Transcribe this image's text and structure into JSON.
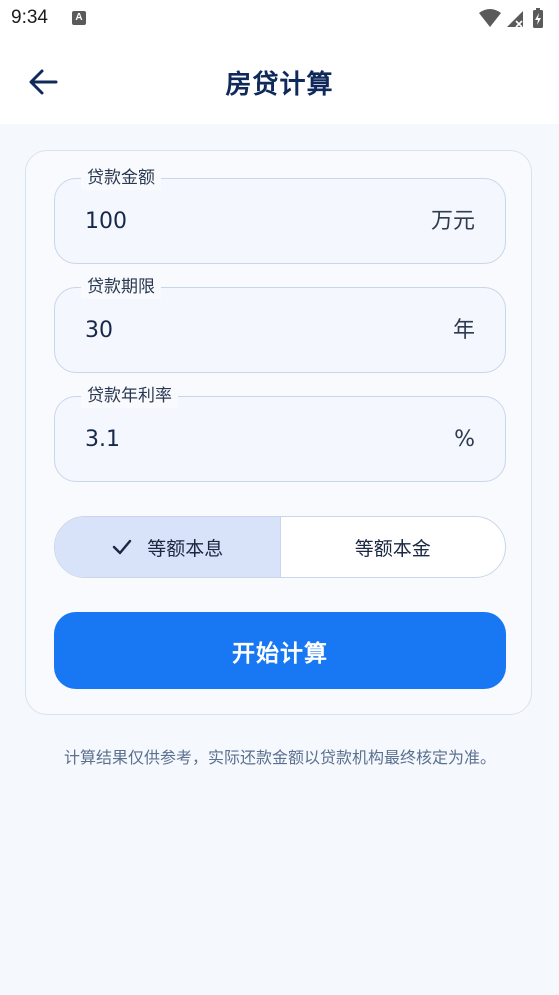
{
  "status_bar": {
    "time": "9:34",
    "notification_glyph": "A",
    "icons": [
      "wifi-icon",
      "signal-icon",
      "battery-charging-icon"
    ]
  },
  "app_bar": {
    "title": "房贷计算",
    "back_icon": "arrow-left-icon"
  },
  "form": {
    "loan_amount": {
      "label": "贷款金额",
      "value": "100",
      "unit": "万元"
    },
    "loan_term": {
      "label": "贷款期限",
      "value": "30",
      "unit": "年"
    },
    "interest_rate": {
      "label": "贷款年利率",
      "value": "3.1",
      "unit": "%"
    }
  },
  "repayment_method": {
    "options": [
      "等额本息",
      "等额本金"
    ],
    "selected": "等额本息"
  },
  "actions": {
    "calculate_label": "开始计算"
  },
  "disclaimer": "计算结果仅供参考，实际还款金额以贷款机构最终核定为准。",
  "colors": {
    "primary": "#1877f2",
    "title": "#0f2a5a",
    "segment_selected": "#d8e2f8",
    "background": "#f5f8fd"
  }
}
